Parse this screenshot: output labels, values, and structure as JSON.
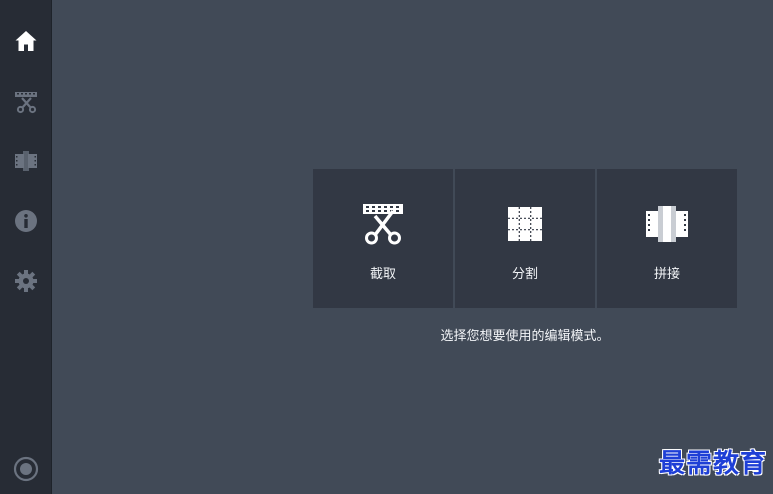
{
  "sidebar": {
    "items": [
      {
        "icon": "home-icon",
        "active": true
      },
      {
        "icon": "trim-icon",
        "active": false
      },
      {
        "icon": "join-film-icon",
        "active": false
      },
      {
        "icon": "info-icon",
        "active": false
      },
      {
        "icon": "gear-icon",
        "active": false
      }
    ],
    "bottom_icon": "record-icon"
  },
  "modes": [
    {
      "icon": "film-scissors-icon",
      "label": "截取"
    },
    {
      "icon": "split-grid-icon",
      "label": "分割"
    },
    {
      "icon": "merge-film-icon",
      "label": "拼接"
    }
  ],
  "hint": "选择您想要使用的编辑模式。",
  "watermark": "最需教育",
  "colors": {
    "background": "#414a57",
    "sidebar": "#272c35",
    "tile": "#323844",
    "text": "#f2f4f7",
    "icon_active": "#ffffff",
    "icon_inactive": "#6b7380",
    "watermark": "#1e3fd6"
  }
}
